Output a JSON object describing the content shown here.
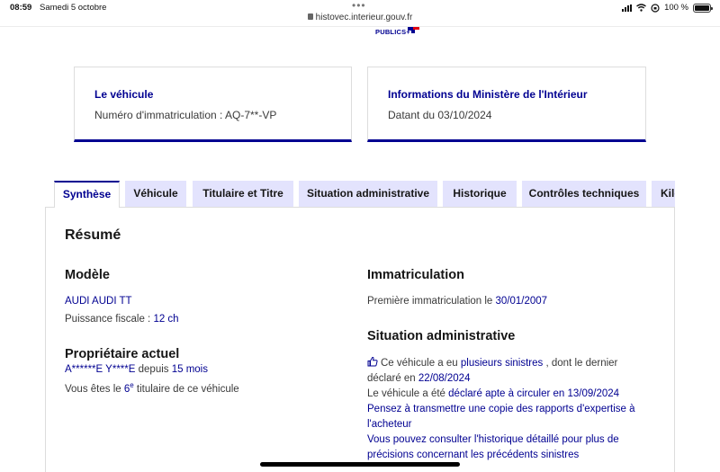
{
  "status": {
    "time": "08:59",
    "date": "Samedi 5 octobre",
    "url": "histovec.interieur.gouv.fr",
    "battery": "100 %"
  },
  "logo": {
    "text": "PUBLICS+"
  },
  "cards": [
    {
      "title": "Le véhicule",
      "value": "Numéro d'immatriculation : AQ-7**-VP"
    },
    {
      "title": "Informations du Ministère de l'Intérieur",
      "value": "Datant du 03/10/2024"
    }
  ],
  "tabs": [
    {
      "label": "Synthèse",
      "active": true
    },
    {
      "label": "Véhicule"
    },
    {
      "label": "Titulaire et Titre"
    },
    {
      "label": "Situation administrative"
    },
    {
      "label": "Historique"
    },
    {
      "label": "Contrôles techniques"
    },
    {
      "label": "Kilo"
    }
  ],
  "summary": {
    "heading": "Résumé",
    "modele": {
      "heading": "Modèle",
      "name": "AUDI AUDI TT",
      "puissance_label": "Puissance fiscale : ",
      "puissance_value": "12 ch"
    },
    "proprietaire": {
      "heading": "Propriétaire actuel",
      "name": "A******E Y****E",
      "depuis": " depuis ",
      "duree": "15 mois",
      "rank_prefix": "Vous êtes le ",
      "rank_num": "6",
      "rank_sup": "e",
      "rank_suffix": " titulaire de ce véhicule"
    },
    "immatriculation": {
      "heading": "Immatriculation",
      "label": "Première immatriculation le ",
      "date": "30/01/2007"
    },
    "situation": {
      "heading": "Situation administrative",
      "line1_a": "Ce véhicule a eu ",
      "line1_link": "plusieurs sinistres",
      "line1_b": " , dont le dernier",
      "line2_a": "déclaré en ",
      "line2_date": "22/08/2024",
      "line3_a": "Le véhicule a été ",
      "line3_link": "déclaré apte à circuler en 13/09/2024",
      "line4": "Pensez à transmettre une copie des rapports d'expertise à",
      "line5": "l'acheteur",
      "line6": "Vous pouvez consulter l'historique détaillé pour plus de",
      "line7": "précisions concernant les précédents sinistres"
    }
  },
  "colors": {
    "accent": "#000091",
    "tab_bg": "#e3e3fd",
    "border": "#dddddd"
  }
}
